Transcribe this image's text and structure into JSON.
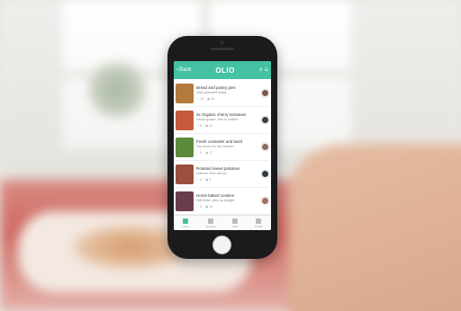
{
  "app": {
    "title": "OLIO",
    "back_label": "Back",
    "accent": "#45c1a3"
  },
  "listings": [
    {
      "title": "Bread and pastry pies",
      "subtitle": "Just collected today",
      "likes": "12",
      "views": "34",
      "thumb_color": "#b27a3c",
      "avatar_color": "#7d5b4a"
    },
    {
      "title": "3x Organic cherry tomatoes",
      "subtitle": "Home grown, free to collect",
      "likes": "8",
      "views": "21",
      "thumb_color": "#c45a3b",
      "avatar_color": "#3b3b3b"
    },
    {
      "title": "Fresh coriander and basil",
      "subtitle": "Too much for our kitchen",
      "likes": "5",
      "views": "17",
      "thumb_color": "#5d8a3a",
      "avatar_color": "#8a6b5c"
    },
    {
      "title": "Roasted sweet potatoes",
      "subtitle": "Leftover from dinner",
      "likes": "3",
      "views": "9",
      "thumb_color": "#9b4f3c",
      "avatar_color": "#2f3a46"
    },
    {
      "title": "Home baked cookies",
      "subtitle": "Still fresh, pick up tonight",
      "likes": "6",
      "views": "14",
      "thumb_color": "#6b3d4c",
      "avatar_color": "#a07060"
    }
  ],
  "tabs": [
    {
      "label": "Home"
    },
    {
      "label": "Explore"
    },
    {
      "label": "Chat"
    },
    {
      "label": "Profile"
    }
  ]
}
